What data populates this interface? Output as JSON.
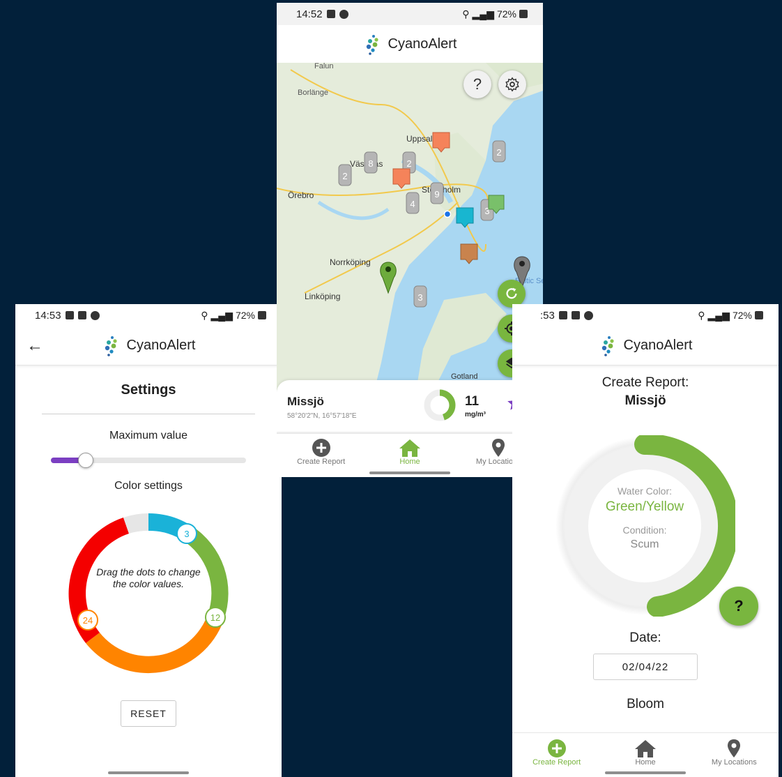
{
  "app_name": "CyanoAlert",
  "colors": {
    "accent": "#79b63f",
    "purple": "#7b3fc2",
    "background": "#02203a"
  },
  "settings_screen": {
    "status": {
      "time": "14:53",
      "battery": "72%"
    },
    "title": "Settings",
    "maximum_value_label": "Maximum value",
    "maximum_value_fraction": 0.18,
    "color_settings_label": "Color settings",
    "ring_hint": "Drag the dots to change the color values.",
    "dots": [
      "3",
      "12",
      "24"
    ],
    "reset_label": "RESET"
  },
  "map_screen": {
    "status": {
      "time": "14:52",
      "battery": "72%"
    },
    "place_labels": [
      "Falun",
      "Borlänge",
      "Uppsala",
      "Västerås",
      "Örebro",
      "Stockholm",
      "Norrköping",
      "Linköping",
      "Gotland",
      "Baltic Sea"
    ],
    "cluster_counts": [
      "2",
      "8",
      "2",
      "2",
      "9",
      "4",
      "3",
      "3"
    ],
    "card": {
      "lake_name": "Missjö",
      "coordinates": "58°20'2\"N, 16°57'18\"E",
      "value": "11",
      "unit": "mg/m³",
      "gauge_fraction": 0.45
    }
  },
  "report_screen": {
    "status": {
      "time": ":53",
      "battery": "72%"
    },
    "title": "Create Report:",
    "lake_name": "Missjö",
    "water_color_label": "Water Color:",
    "water_color_value": "Green/Yellow",
    "condition_label": "Condition:",
    "condition_value": "Scum",
    "help_label": "?",
    "date_label": "Date:",
    "date_value": "02/04/22",
    "bloom_label": "Bloom"
  },
  "nav": {
    "create_report": "Create Report",
    "home": "Home",
    "my_locations": "My Locations"
  }
}
